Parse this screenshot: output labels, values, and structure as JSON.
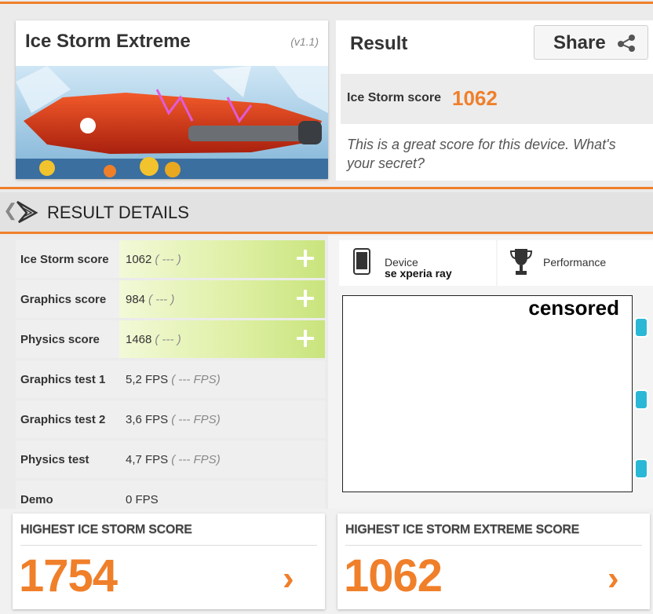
{
  "benchmark": {
    "title": "Ice Storm Extreme",
    "version": "(v1.1)"
  },
  "result": {
    "title": "Result",
    "share_label": "Share",
    "score_label": "Ice Storm score",
    "score_value": "1062",
    "message": "This is a great score for this device. What's your secret?"
  },
  "details": {
    "title": "RESULT DETAILS"
  },
  "table": [
    {
      "label": "Ice Storm score",
      "value": "1062",
      "sub": "( --- )",
      "highlight": true
    },
    {
      "label": "Graphics score",
      "value": "984",
      "sub": "( --- )",
      "highlight": true
    },
    {
      "label": "Physics score",
      "value": "1468",
      "sub": "( --- )",
      "highlight": true
    },
    {
      "label": "Graphics test 1",
      "value": "5,2 FPS",
      "sub": "( --- FPS)",
      "highlight": false
    },
    {
      "label": "Graphics test 2",
      "value": "3,6 FPS",
      "sub": "( --- FPS)",
      "highlight": false
    },
    {
      "label": "Physics test",
      "value": "4,7 FPS",
      "sub": "( --- FPS)",
      "highlight": false
    },
    {
      "label": "Demo",
      "value": "0 FPS",
      "sub": "",
      "highlight": false
    }
  ],
  "tabs": {
    "device_label": "Device",
    "device_name": "se xperia ray",
    "performance_label": "Performance"
  },
  "censor": {
    "text": "censored"
  },
  "highest": [
    {
      "title": "HIGHEST ICE STORM SCORE",
      "score": "1754"
    },
    {
      "title": "HIGHEST ICE STORM EXTREME SCORE",
      "score": "1062"
    }
  ],
  "colors": {
    "accent": "#f07f2a",
    "highlight": "#c9e47d",
    "slider": "#2ab8d6"
  },
  "icons": [
    "share-icon",
    "futuremark-logo-icon",
    "phone-icon",
    "trophy-icon",
    "plus-icon",
    "chevron-right-icon"
  ]
}
